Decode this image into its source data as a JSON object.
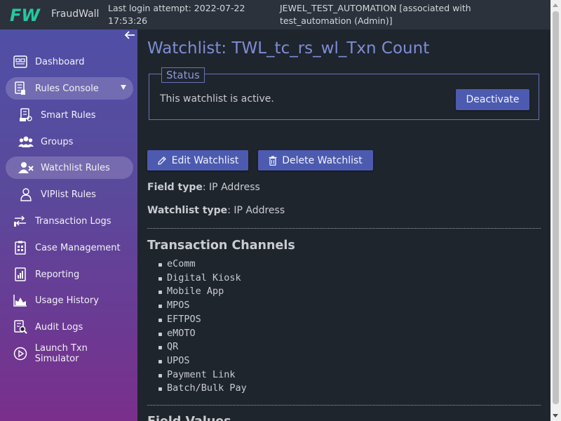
{
  "header": {
    "brand": "FraudWall",
    "logo_text": "FW",
    "login_line1": "Last login attempt: 2022-07-22",
    "login_line2": "17:53:26",
    "user_line1": "JEWEL_TEST_AUTOMATION [associated with",
    "user_line2": "test_automation (Admin)]"
  },
  "sidebar": {
    "items": [
      {
        "label": "Dashboard",
        "icon": "dashboard-icon"
      },
      {
        "label": "Rules Console",
        "icon": "rules-console-icon"
      },
      {
        "label": "Smart Rules",
        "icon": "smart-rules-icon"
      },
      {
        "label": "Groups",
        "icon": "groups-icon"
      },
      {
        "label": "Watchlist Rules",
        "icon": "watchlist-icon"
      },
      {
        "label": "VIPlist Rules",
        "icon": "viplist-icon"
      },
      {
        "label": "Transaction Logs",
        "icon": "transaction-logs-icon"
      },
      {
        "label": "Case Management",
        "icon": "case-management-icon"
      },
      {
        "label": "Reporting",
        "icon": "reporting-icon"
      },
      {
        "label": "Usage History",
        "icon": "usage-history-icon"
      },
      {
        "label": "Audit Logs",
        "icon": "audit-logs-icon"
      },
      {
        "label": "Launch Txn Simulator",
        "icon": "launch-simulator-icon"
      }
    ]
  },
  "main": {
    "title": "Watchlist: TWL_tc_rs_wl_Txn Count",
    "status": {
      "legend": "Status",
      "text": "This watchlist is active.",
      "deactivate_label": "Deactivate"
    },
    "edit_label": "Edit Watchlist",
    "delete_label": "Delete Watchlist",
    "field_type_label": "Field type",
    "field_type_value": ": IP Address",
    "watchlist_type_label": "Watchlist type",
    "watchlist_type_value": ": IP Address",
    "channels_heading": "Transaction Channels",
    "channels": [
      "eComm",
      "Digital Kiosk",
      "Mobile App",
      "MPOS",
      "EFTPOS",
      "eMOTO",
      "QR",
      "UPOS",
      "Payment Link",
      "Batch/Bulk Pay"
    ],
    "field_values_heading": "Field Values"
  },
  "colors": {
    "accent": "#7e8dd6",
    "button": "#4c5bb0",
    "sidebar_top": "#4f4fa6",
    "sidebar_bottom": "#7a2f8c"
  }
}
